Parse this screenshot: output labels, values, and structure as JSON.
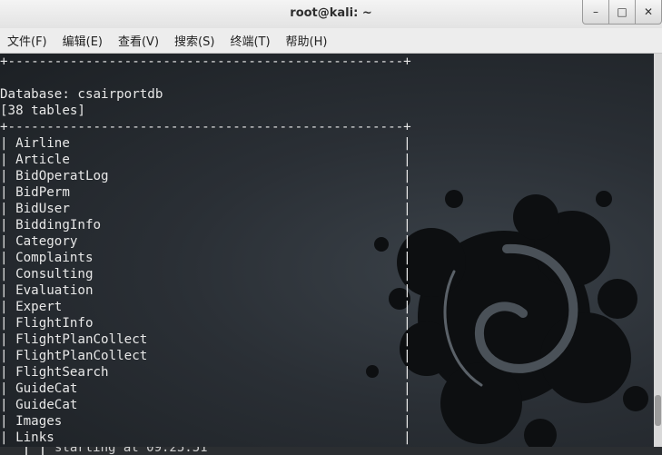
{
  "window": {
    "title": "root@kali: ~",
    "buttons": {
      "minimize": "–",
      "maximize": "□",
      "close": "✕"
    }
  },
  "menu": [
    "文件(F)",
    "编辑(E)",
    "查看(V)",
    "搜索(S)",
    "终端(T)",
    "帮助(H)"
  ],
  "terminal": {
    "lines": [
      "+---------------------------------------------------+",
      "",
      "Database: csairportdb",
      "[38 tables]",
      "+---------------------------------------------------+",
      "| Airline                                           |",
      "| Article                                           |",
      "| BidOperatLog                                      |",
      "| BidPerm                                           |",
      "| BidUser                                           |",
      "| BiddingInfo                                       |",
      "| Category                                          |",
      "| Complaints                                        |",
      "| Consulting                                        |",
      "| Evaluation                                        |",
      "| Expert                                            |",
      "| FlightInfo                                        |",
      "| FlightPlanCollect                                 |",
      "| FlightPlanCollect                                 |",
      "| FlightSearch                                      |",
      "| GuideCat                                          |",
      "| GuideCat                                          |",
      "| Images                                            |",
      "| Links                                             |"
    ]
  },
  "background_window": {
    "text": "starting at 09:25:51"
  },
  "colors": {
    "terminal_text": "#e8e8e8",
    "terminal_bg": "#2a2f35",
    "menubar_bg": "#ededed"
  }
}
